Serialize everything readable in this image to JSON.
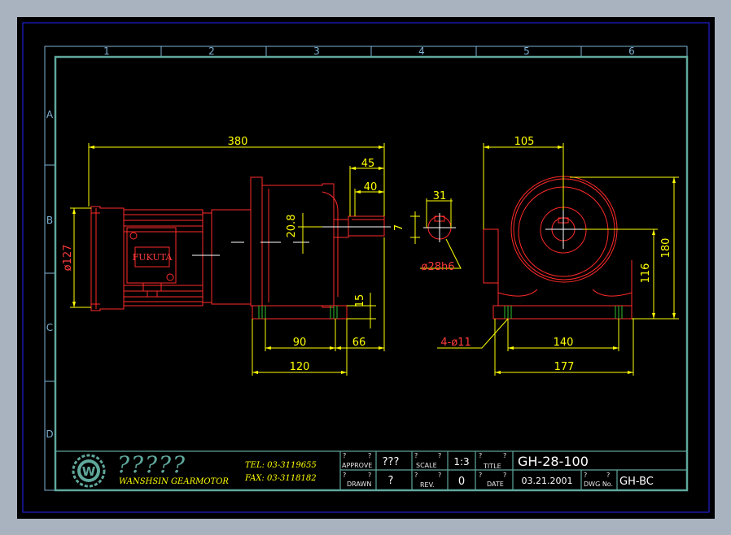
{
  "grid": {
    "columns": [
      "1",
      "2",
      "3",
      "4",
      "5",
      "6"
    ],
    "rows": [
      "A",
      "B",
      "C",
      "D"
    ]
  },
  "dimensions": {
    "overall_length": "380",
    "d45": "45",
    "d40": "40",
    "shaft_height": "20.8",
    "key_width": "7",
    "key_depth": "31",
    "shaft_dia": "ø28h6",
    "motor_dia": "ø127",
    "foot_height": "15",
    "d90": "90",
    "d66": "66",
    "d120": "120",
    "end_width": "105",
    "height_180": "180",
    "height_116": "116",
    "foot_holes": "4-ø11",
    "d140": "140",
    "d177": "177"
  },
  "motor_label": "FUKUTA",
  "title_block": {
    "company_cn": "?????",
    "company": "WANSHSIN GEARMOTOR",
    "tel": "TEL:  03-3119655",
    "fax": "FAX:  03-3118182",
    "q1": "?",
    "q2": "?",
    "approve_label": "APPROVE",
    "approve_value": "???",
    "scale_label": "SCALE",
    "scale_value": "1:3",
    "title_label": "TITLE",
    "title_value": "GH-28-100",
    "drawn_label": "DRAWN",
    "drawn_value": "?",
    "rev_label": "REV.",
    "rev_value": "0",
    "date_label": "DATE",
    "date_value": "03.21.2001",
    "dwg_label": "DWG  No.",
    "dwg_value": "GH-BC"
  },
  "colors": {
    "background": "#000000",
    "outline": "#ff2a2a",
    "dimension": "#ffff00",
    "frame": "#5fa89c",
    "grid_border": "#7fb3d5",
    "feet": "#2fbf2f"
  }
}
